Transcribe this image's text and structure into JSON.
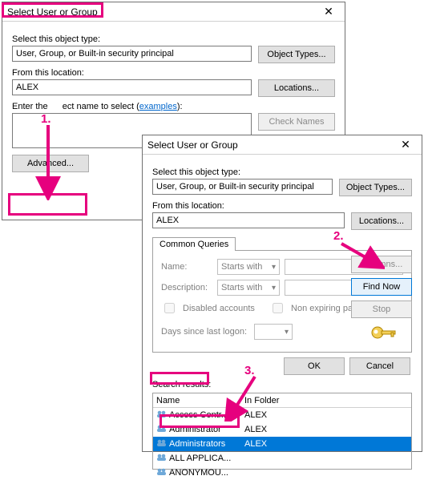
{
  "dialog1": {
    "title": "Select User or Group",
    "obj_label": "Select this object type:",
    "obj_value": "User, Group, or Built-in security principal",
    "obj_btn": "Object Types...",
    "loc_label": "From this location:",
    "loc_value": "ALEX",
    "loc_btn": "Locations...",
    "name_label_pre": "Enter the",
    "name_label_post": "ect name to select (",
    "examples": "examples",
    "name_label_close": "):",
    "check_btn": "Check Names",
    "advanced_btn": "Advanced..."
  },
  "dialog2": {
    "title": "Select User or Group",
    "obj_label": "Select this object type:",
    "obj_value": "User, Group, or Built-in security principal",
    "obj_btn": "Object Types...",
    "loc_label": "From this location:",
    "loc_value": "ALEX",
    "loc_btn": "Locations...",
    "tab": "Common Queries",
    "name_lbl": "Name:",
    "desc_lbl": "Description:",
    "starts_with": "Starts with",
    "cb_disabled": "Disabled accounts",
    "cb_nonexp": "Non expiring password",
    "days_lbl": "Days since last logon:",
    "btn_columns": "Columns...",
    "btn_findnow": "Find Now",
    "btn_stop": "Stop",
    "btn_ok": "OK",
    "btn_cancel": "Cancel",
    "search_label": "Search results:",
    "col_name": "Name",
    "col_folder": "In Folder",
    "rows": [
      {
        "name": "Access Contr...",
        "folder": "ALEX"
      },
      {
        "name": "Administrator",
        "folder": "ALEX"
      },
      {
        "name": "Administrators",
        "folder": "ALEX"
      },
      {
        "name": "ALL APPLICA...",
        "folder": ""
      },
      {
        "name": "ANONYMOU...",
        "folder": ""
      }
    ],
    "selected_index": 2
  },
  "annotations": {
    "step1": "1.",
    "step2": "2.",
    "step3": "3."
  }
}
